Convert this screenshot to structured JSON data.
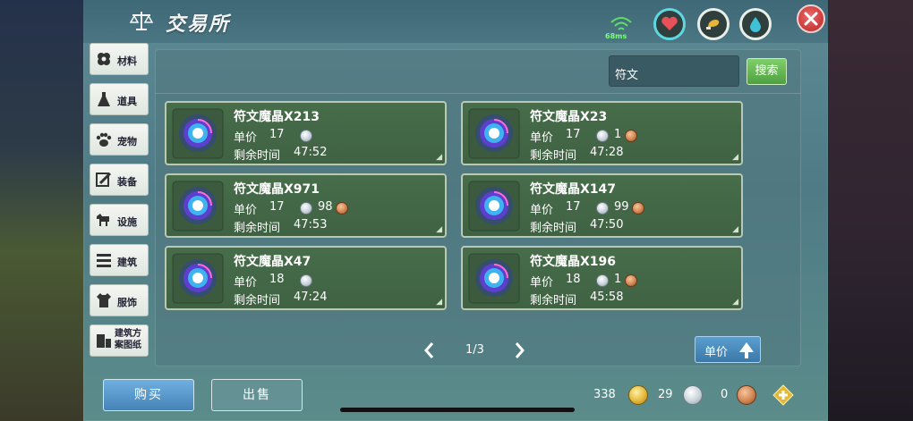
{
  "title": "交易所",
  "status": {
    "ping": "68ms"
  },
  "sidebar": {
    "items": [
      {
        "label": "材料",
        "icon": "flower-icon"
      },
      {
        "label": "道具",
        "icon": "flask-icon"
      },
      {
        "label": "宠物",
        "icon": "paw-icon"
      },
      {
        "label": "装备",
        "icon": "sword-icon"
      },
      {
        "label": "设施",
        "icon": "horse-icon"
      },
      {
        "label": "建筑",
        "icon": "building-icon"
      },
      {
        "label": "服饰",
        "icon": "shirt-icon"
      },
      {
        "label": "建筑方案图纸",
        "icon": "blueprint-icon"
      }
    ]
  },
  "search": {
    "value": "符文",
    "button_label": "搜索"
  },
  "labels": {
    "price": "单价",
    "time_left": "剩余时间"
  },
  "listings": [
    {
      "name": "符文魔晶X213",
      "silver": "17",
      "copper": "",
      "time": "47:52"
    },
    {
      "name": "符文魔晶X23",
      "silver": "17",
      "copper": "1",
      "time": "47:28"
    },
    {
      "name": "符文魔晶X971",
      "silver": "17",
      "copper": "98",
      "time": "47:53"
    },
    {
      "name": "符文魔晶X147",
      "silver": "17",
      "copper": "99",
      "time": "47:50"
    },
    {
      "name": "符文魔晶X47",
      "silver": "18",
      "copper": "",
      "time": "47:24"
    },
    {
      "name": "符文魔晶X196",
      "silver": "18",
      "copper": "1",
      "time": "45:58"
    }
  ],
  "pager": {
    "text": "1/3"
  },
  "sort": {
    "label": "单价"
  },
  "actions": {
    "buy": "购买",
    "sell": "出售"
  },
  "currency": {
    "gold": "338",
    "silver": "29",
    "copper": "0"
  },
  "colors": {
    "panel_green": "#476d4a",
    "buy_blue": "#4683b8",
    "search_green": "#4fa041",
    "close_red": "#c73838"
  }
}
